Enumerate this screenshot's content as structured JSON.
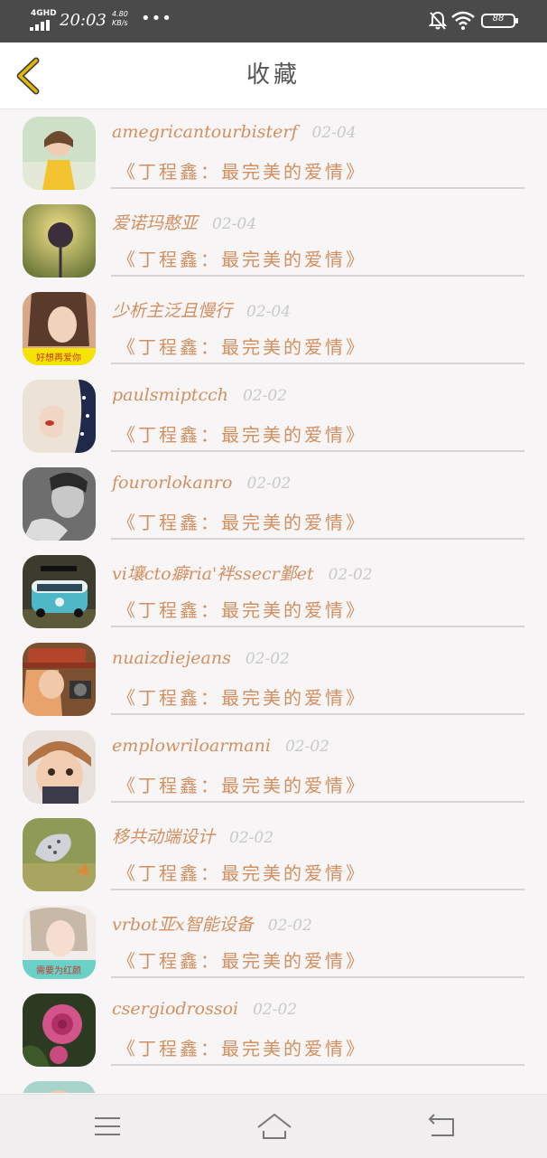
{
  "status_bar": {
    "network": "4GHD",
    "time": "20:03",
    "speed_value": "4.80",
    "speed_unit": "KB/s",
    "more": "•••",
    "battery": "88"
  },
  "header": {
    "title": "收藏"
  },
  "favorites": [
    {
      "user": "amegricantourbisterf",
      "date": "02-04",
      "title": "《丁程鑫：最完美的爱情》"
    },
    {
      "user": "爱诺玛憨亚",
      "date": "02-04",
      "title": "《丁程鑫：最完美的爱情》"
    },
    {
      "user": "少析主泛且慢行",
      "date": "02-04",
      "title": "《丁程鑫：最完美的爱情》"
    },
    {
      "user": "paulsmiptcch",
      "date": "02-02",
      "title": "《丁程鑫：最完美的爱情》"
    },
    {
      "user": "fourorlokanro",
      "date": "02-02",
      "title": "《丁程鑫：最完美的爱情》"
    },
    {
      "user": "vi壤cto癖ria'袢ssecr鄞et",
      "date": "02-02",
      "title": "《丁程鑫：最完美的爱情》"
    },
    {
      "user": "nuaizdiejeans",
      "date": "02-02",
      "title": "《丁程鑫：最完美的爱情》"
    },
    {
      "user": "emplowriloarmani",
      "date": "02-02",
      "title": "《丁程鑫：最完美的爱情》"
    },
    {
      "user": "移共动端设计",
      "date": "02-02",
      "title": "《丁程鑫：最完美的爱情》"
    },
    {
      "user": "vrbot亚x智能设备",
      "date": "02-02",
      "title": "《丁程鑫：最完美的爱情》"
    },
    {
      "user": "csergiodrossoi",
      "date": "02-02",
      "title": "《丁程鑫：最完美的爱情》"
    }
  ],
  "avatar_captions": {
    "a3": "好想再爱你",
    "a10": "需要为红颜"
  },
  "colors": {
    "accent": "#d29060",
    "back_arrow": "#e6b800",
    "date": "#c9c9c9"
  },
  "icons": [
    "back-arrow-icon",
    "menu-icon",
    "home-icon",
    "return-icon",
    "mute-bell-icon",
    "wifi-icon",
    "battery-icon",
    "signal-icon"
  ]
}
